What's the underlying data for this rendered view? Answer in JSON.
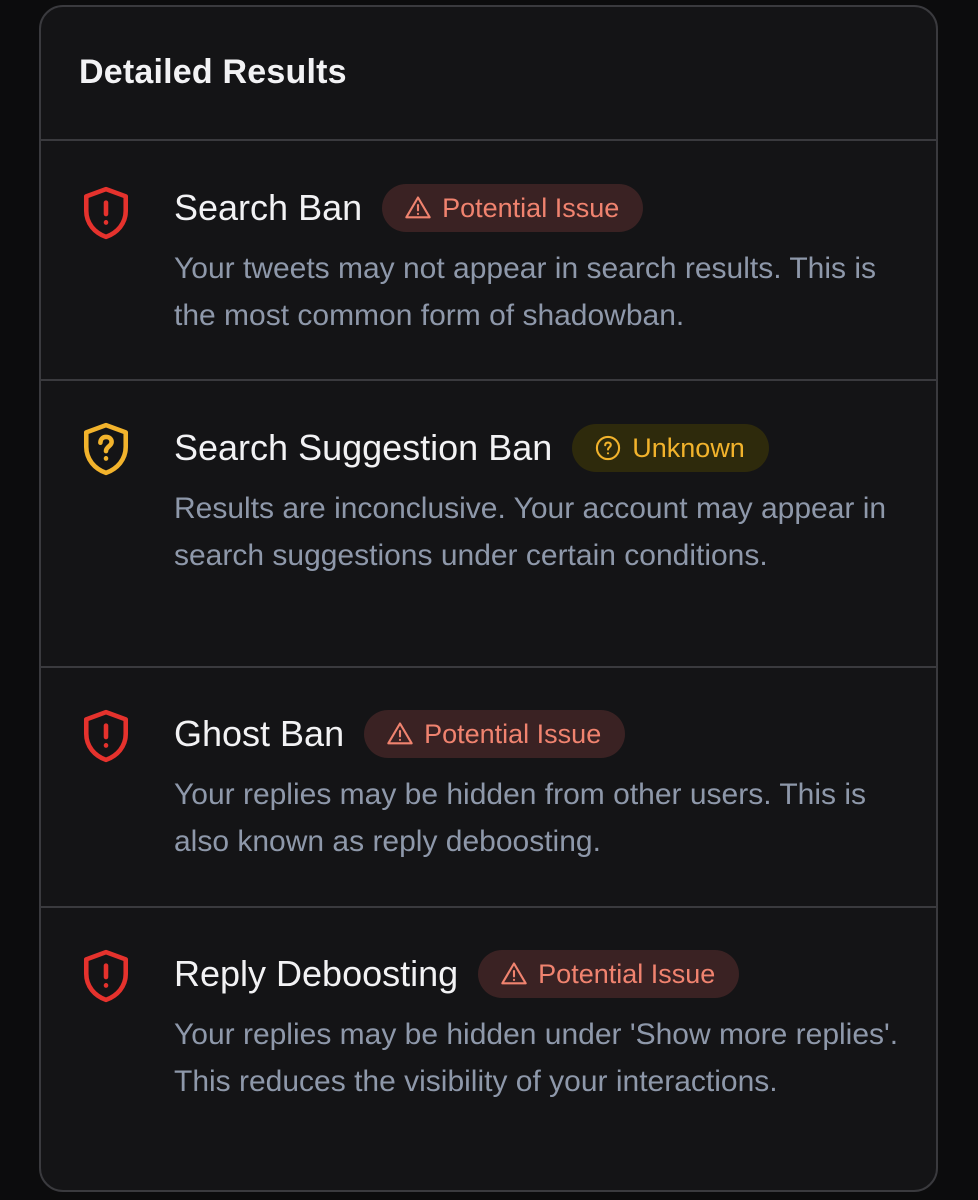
{
  "card": {
    "title": "Detailed Results"
  },
  "results": [
    {
      "title": "Search Ban",
      "status": "Potential Issue",
      "status_type": "issue",
      "icon": "shield-alert-icon",
      "description": "Your tweets may not appear in search results. This is the most common form of shadowban."
    },
    {
      "title": "Search Suggestion Ban",
      "status": "Unknown",
      "status_type": "unknown",
      "icon": "shield-question-icon",
      "description": "Results are inconclusive. Your account may appear in search suggestions under certain conditions."
    },
    {
      "title": "Ghost Ban",
      "status": "Potential Issue",
      "status_type": "issue",
      "icon": "shield-alert-icon",
      "description": "Your replies may be hidden from other users. This is also known as reply deboosting."
    },
    {
      "title": "Reply Deboosting",
      "status": "Potential Issue",
      "status_type": "issue",
      "icon": "shield-alert-icon",
      "description": "Your replies may be hidden under 'Show more replies'. This reduces the visibility of your interactions."
    }
  ],
  "colors": {
    "issue": "#e5322d",
    "unknown": "#f2b32c",
    "card_background": "#141416",
    "border": "#3a3a3e"
  }
}
